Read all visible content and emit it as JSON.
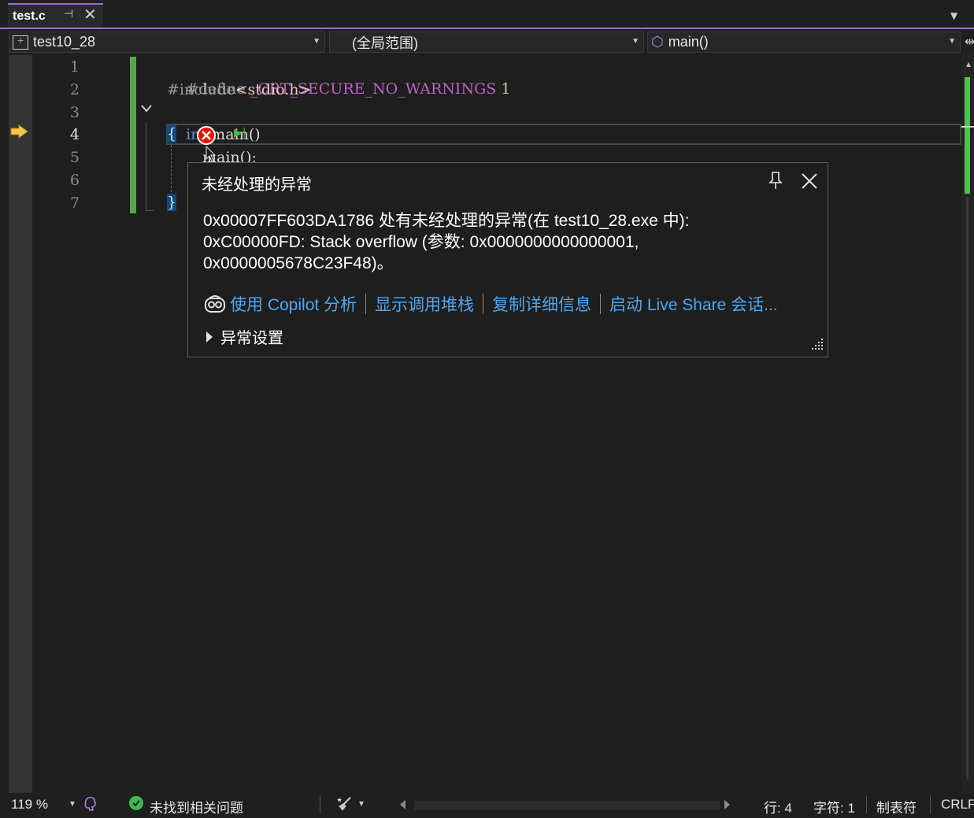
{
  "tab": {
    "title": "test.c",
    "pin_icon": "pin-icon",
    "close_icon": "close-icon"
  },
  "navbar": {
    "project": "test10_28",
    "scope": "(全局范围)",
    "function": "main()"
  },
  "editor": {
    "line_numbers": [
      "1",
      "2",
      "3",
      "4",
      "5",
      "6",
      "7"
    ],
    "current_line": 4,
    "lines": {
      "l1_pp": "#define",
      "l1_macro": "_CRT_SECURE_NO_WARNINGS",
      "l1_num": "1",
      "l2_pp": "#include",
      "l2_inc": "<stdio.h>",
      "l3_kw": "int",
      "l3_fn": "main",
      "l3_paren": "()",
      "l4_brace": "{",
      "l5_call": "main();",
      "l7_brace": "}"
    }
  },
  "exception": {
    "title": "未经处理的异常",
    "message_line1": "0x00007FF603DA1786 处有未经处理的异常(在 test10_28.exe 中):",
    "message_line2": "0xC00000FD: Stack overflow (参数: 0x0000000000000001,",
    "message_line3": "0x0000005678C23F48)。",
    "links": [
      "使用 Copilot 分析",
      "显示调用堆栈",
      "复制详细信息",
      "启动 Live Share 会话..."
    ],
    "settings_label": "异常设置"
  },
  "statusbar": {
    "zoom": "119 %",
    "issues": "未找到相关问题",
    "line": "行: 4",
    "char": "字符: 1",
    "tabs": "制表符",
    "eol": "CRLF"
  },
  "colors": {
    "accent": "#9b6ed4",
    "change_bar": "#57a64a",
    "link": "#4fa6f0",
    "error": "#e51400"
  }
}
